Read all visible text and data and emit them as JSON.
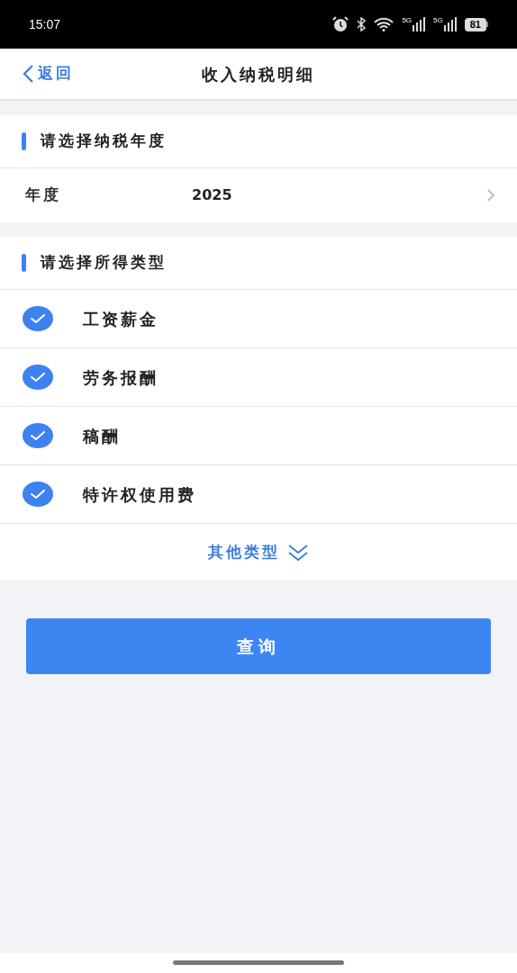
{
  "status_bar": {
    "time": "15:07",
    "signals": [
      "5G",
      "5G"
    ],
    "battery": "81"
  },
  "nav": {
    "back": "返回",
    "title": "收入纳税明细"
  },
  "year_section": {
    "heading": "请选择纳税年度",
    "label": "年度",
    "value": "2025"
  },
  "type_section": {
    "heading": "请选择所得类型",
    "items": [
      {
        "label": "工资薪金",
        "checked": true
      },
      {
        "label": "劳务报酬",
        "checked": true
      },
      {
        "label": "稿酬",
        "checked": true
      },
      {
        "label": "特许权使用费",
        "checked": true
      }
    ],
    "more": "其他类型"
  },
  "query_button": "查询"
}
